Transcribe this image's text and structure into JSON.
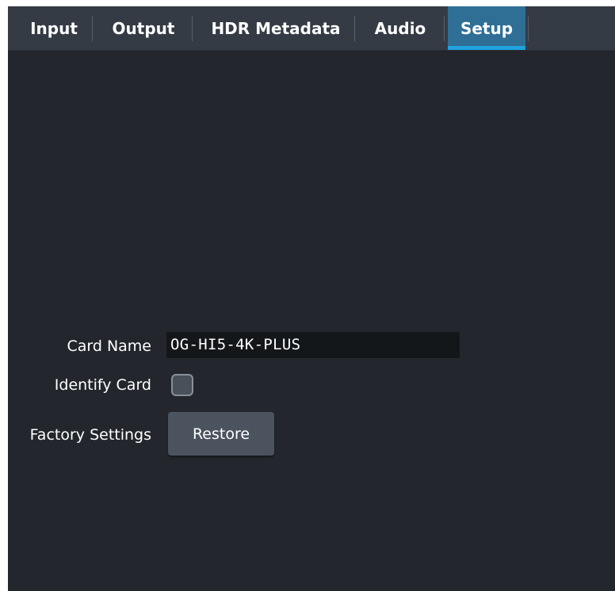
{
  "tabs": [
    {
      "label": "Input",
      "active": false
    },
    {
      "label": "Output",
      "active": false
    },
    {
      "label": "HDR Metadata",
      "active": false
    },
    {
      "label": "Audio",
      "active": false
    },
    {
      "label": "Setup",
      "active": true
    }
  ],
  "setup": {
    "card_name_label": "Card Name",
    "card_name_value": "OG-HI5-4K-PLUS",
    "identify_card_label": "Identify Card",
    "identify_card_checked": false,
    "factory_settings_label": "Factory Settings",
    "restore_button_label": "Restore"
  },
  "colors": {
    "panel_background": "#23272d",
    "tabbar_background": "#353b44",
    "active_tab_background": "#2f6f96",
    "active_tab_indicator": "#1ea3de",
    "text_field_background": "#14171a",
    "button_background": "#4b545e"
  }
}
